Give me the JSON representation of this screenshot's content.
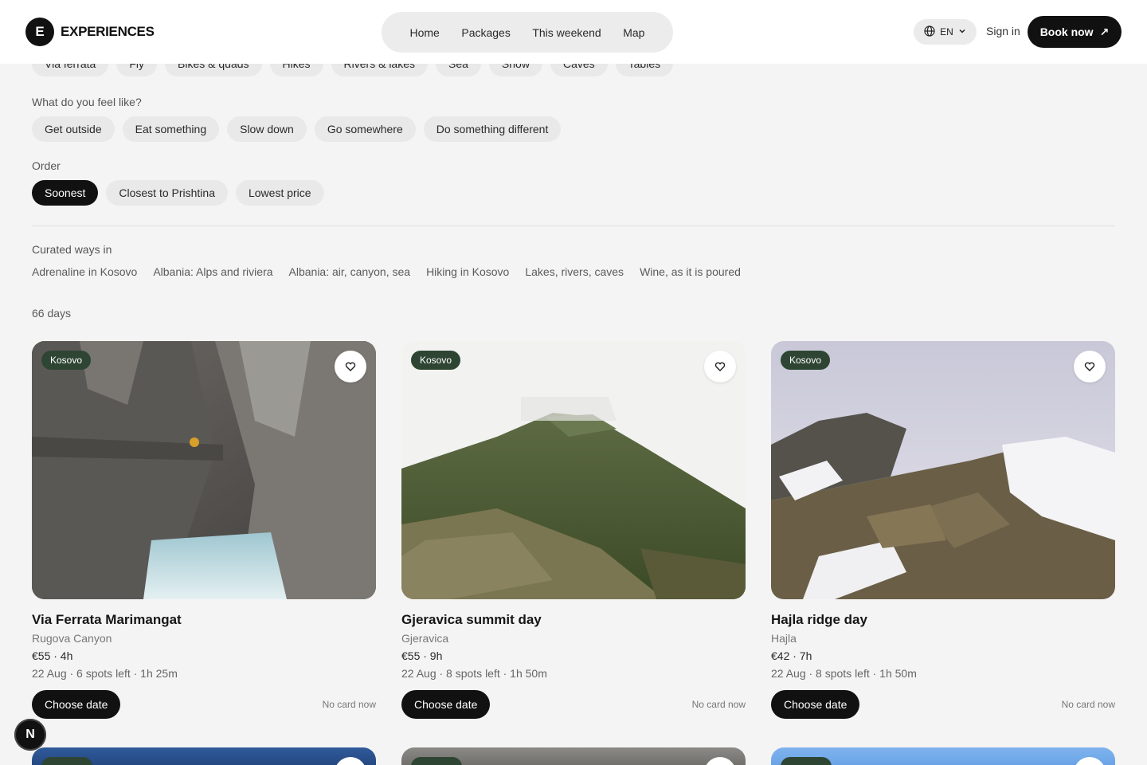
{
  "header": {
    "logo_mark": "E",
    "logo_text": "EXPERIENCES",
    "nav": [
      "Home",
      "Packages",
      "This weekend",
      "Map"
    ],
    "lang": "EN",
    "signin": "Sign in",
    "book": "Book now",
    "book_icon": "↗"
  },
  "categories": [
    "Via ferrata",
    "Fly",
    "Bikes & quads",
    "Hikes",
    "Rivers & lakes",
    "Sea",
    "Snow",
    "Caves",
    "Tables"
  ],
  "mood": {
    "label": "What do you feel like?",
    "options": [
      "Get outside",
      "Eat something",
      "Slow down",
      "Go somewhere",
      "Do something different"
    ]
  },
  "order": {
    "label": "Order",
    "options": [
      "Soonest",
      "Closest to Prishtina",
      "Lowest price"
    ],
    "selected": "Soonest"
  },
  "curated": {
    "label": "Curated ways in",
    "links": [
      "Adrenaline in Kosovo",
      "Albania: Alps and riviera",
      "Albania: air, canyon, sea",
      "Hiking in Kosovo",
      "Lakes, rivers, caves",
      "Wine, as it is poured"
    ]
  },
  "count": "66 days",
  "cards": [
    {
      "badge": "Kosovo",
      "title": "Via Ferrata Marimangat",
      "place": "Rugova Canyon",
      "price": "€55 · 4h",
      "meta": "22 Aug · 6 spots left · 1h 25m",
      "cta": "Choose date",
      "note": "No card now"
    },
    {
      "badge": "Kosovo",
      "title": "Gjeravica summit day",
      "place": "Gjeravica",
      "price": "€55 · 9h",
      "meta": "22 Aug · 8 spots left · 1h 50m",
      "cta": "Choose date",
      "note": "No card now"
    },
    {
      "badge": "Kosovo",
      "title": "Hajla ridge day",
      "place": "Hajla",
      "price": "€42 · 7h",
      "meta": "22 Aug · 8 spots left · 1h 50m",
      "cta": "Choose date",
      "note": "No card now"
    }
  ],
  "fab": "N",
  "colors": {
    "background": "#f4f4f4",
    "primary": "#111111",
    "chip": "#e9e9e9",
    "badge": "#2e4533"
  }
}
